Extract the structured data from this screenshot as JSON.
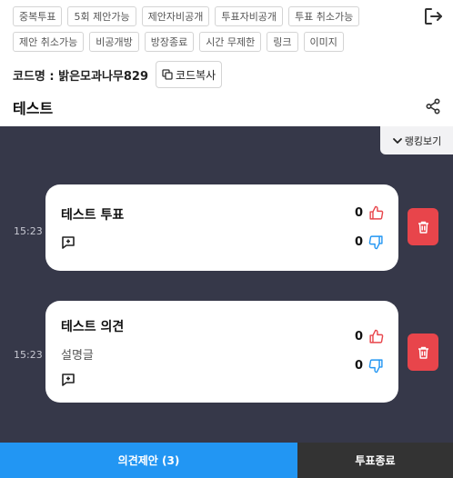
{
  "tags": {
    "row1": [
      "중복투표",
      "5회 제안가능",
      "제안자비공개",
      "투표자비공개",
      "투표 취소가능"
    ],
    "row2": [
      "제안 취소가능",
      "비공개방",
      "방장종료",
      "시간 무제한",
      "링크",
      "이미지"
    ]
  },
  "code": {
    "label": "코드명 : 밝은모과나무829",
    "copy_label": "코드복사"
  },
  "title": "테스트",
  "ranking_label": "랭킹보기",
  "items": [
    {
      "time": "15:23",
      "title": "테스트 투표",
      "desc": "",
      "likes": "0",
      "dislikes": "0"
    },
    {
      "time": "15:23",
      "title": "테스트 의견",
      "desc": "설명글",
      "likes": "0",
      "dislikes": "0"
    }
  ],
  "bottom": {
    "propose_label": "의견제안 (3)",
    "end_label": "투표종료"
  },
  "colors": {
    "board_bg": "#363849",
    "like_red": "#e8454b",
    "dislike_blue": "#2296f3",
    "primary_blue": "#2296f3",
    "dark": "#333333"
  }
}
